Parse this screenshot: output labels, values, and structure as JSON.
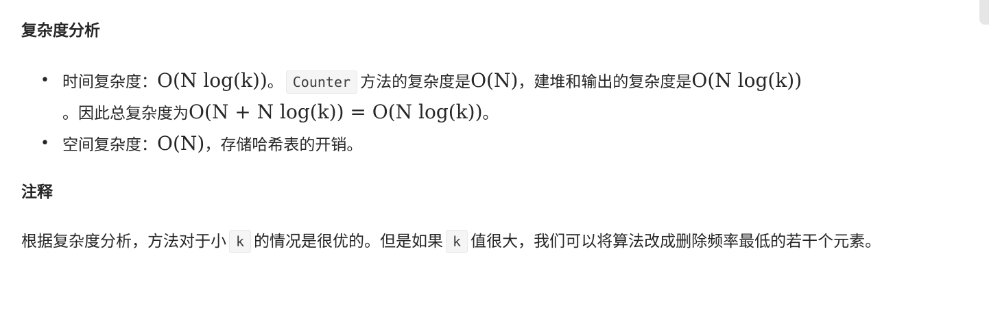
{
  "section1": {
    "title": "复杂度分析"
  },
  "items": [
    {
      "time_label": "时间复杂度：",
      "time_formula": "O(N log(k))",
      "period1": "。",
      "code": "Counter",
      "text2": "方法的复杂度是",
      "formula2": "O(N)",
      "text3": "，建堆和输出的复杂度是",
      "formula3": "O(N log(k))",
      "period2": "。因此总复杂度为",
      "formula4": "O(N + N log(k)) = O(N log(k))",
      "period3": "。"
    },
    {
      "space_label": "空间复杂度：",
      "space_formula": "O(N)",
      "space_text": "，存储哈希表的开销。"
    }
  ],
  "section2": {
    "title": "注释"
  },
  "note": {
    "part1": "根据复杂度分析，方法对于小",
    "code1": "k",
    "part2": "的情况是很优的。但是如果",
    "code2": "k",
    "part3": "值很大，我们可以将算法改成删除频率最低的若干个元素。"
  }
}
